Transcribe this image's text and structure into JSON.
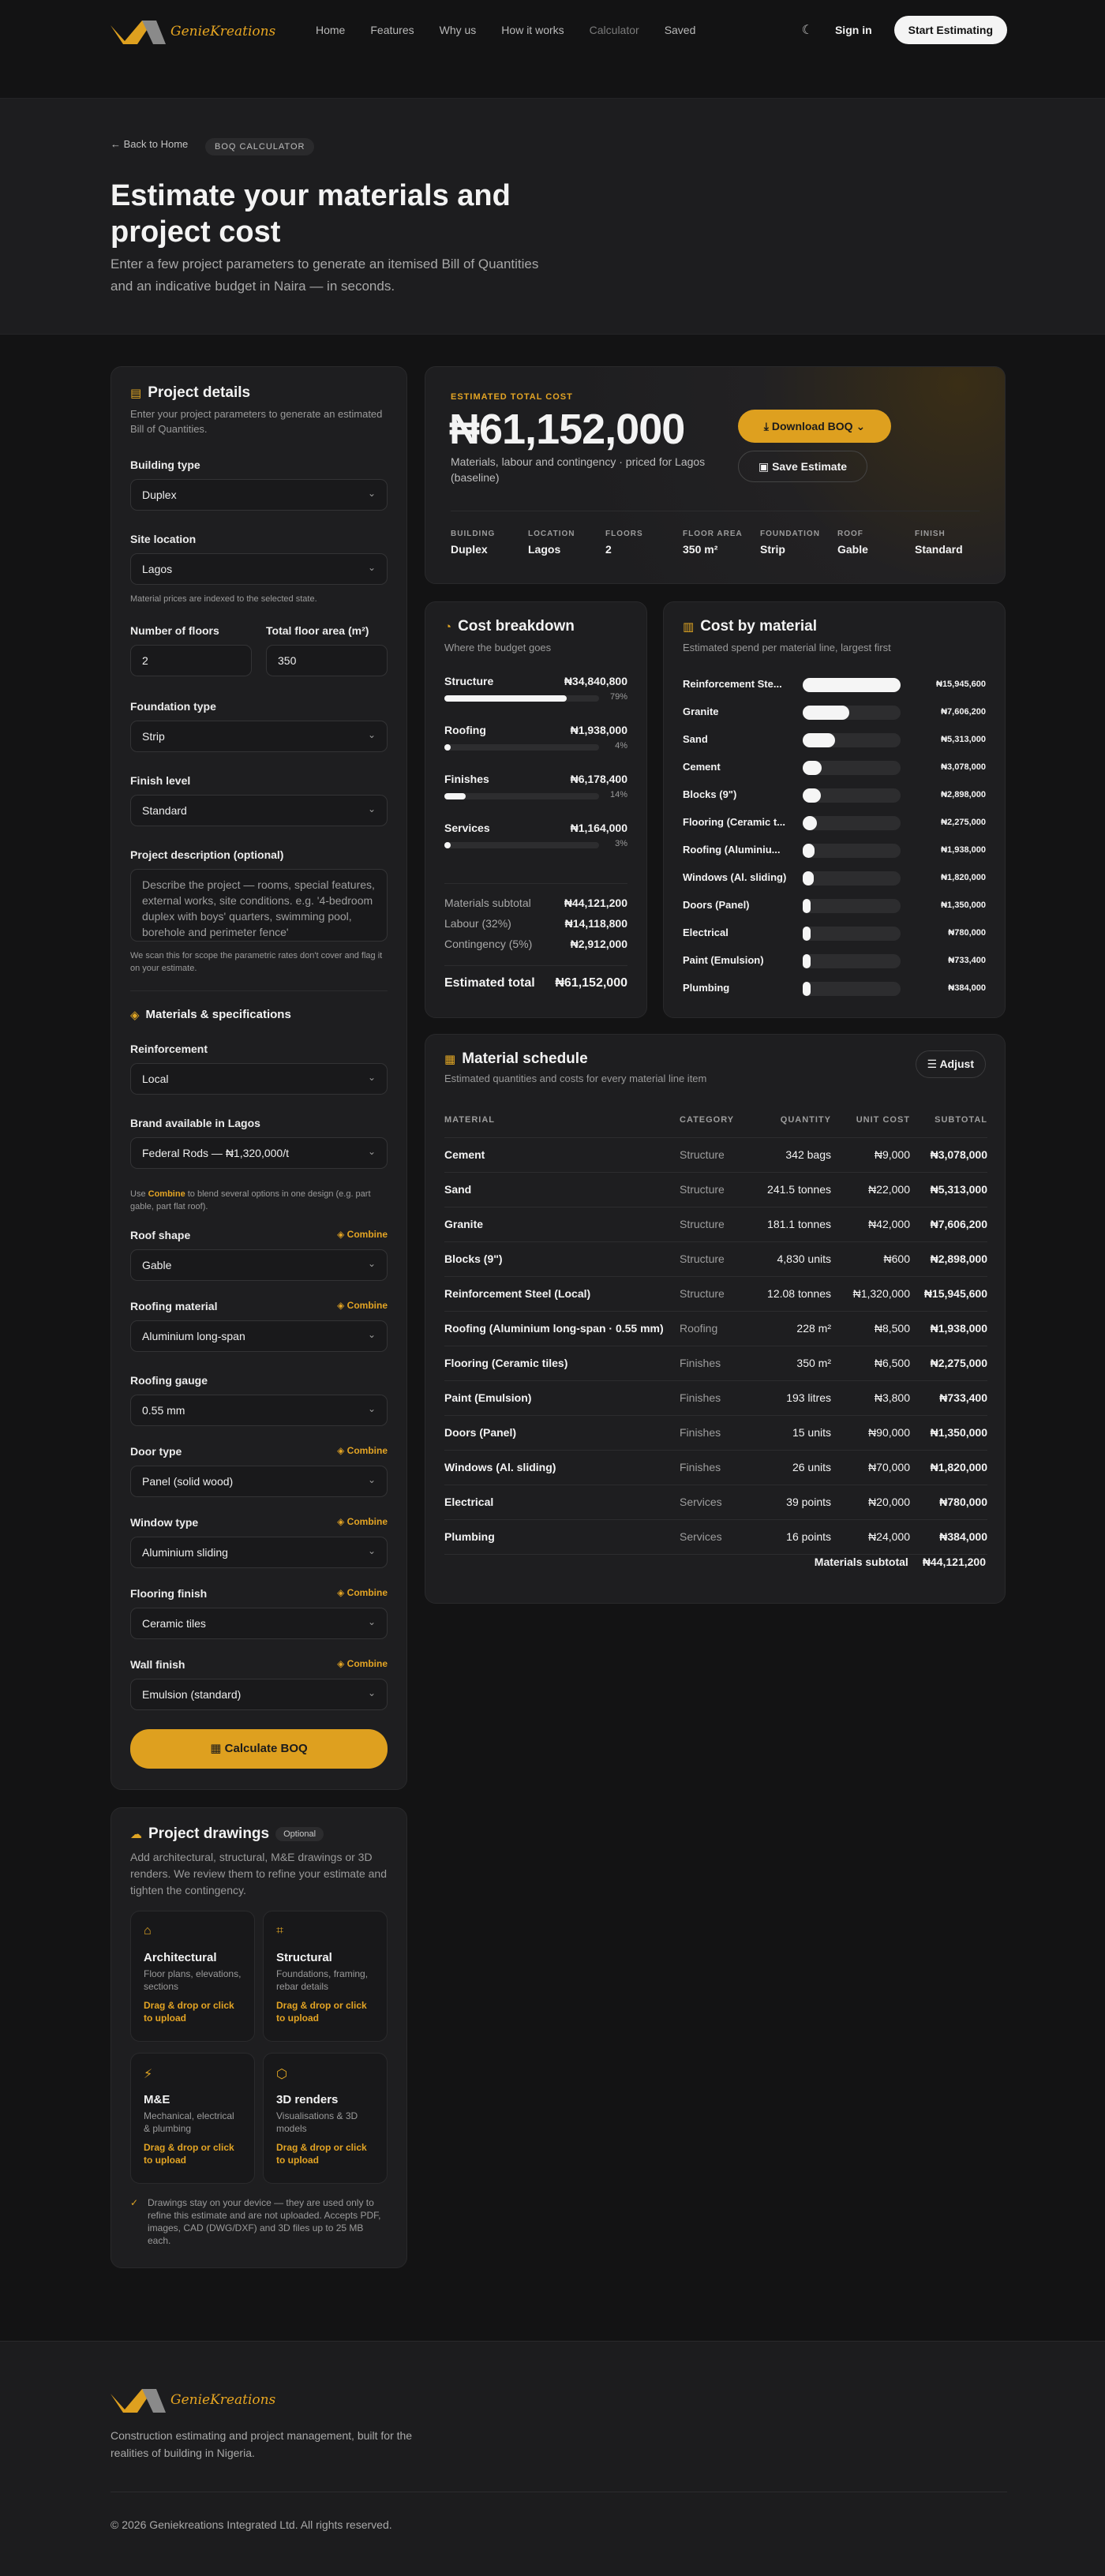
{
  "nav": {
    "brand": "GenieKreations",
    "links": [
      "Home",
      "Features",
      "Why us",
      "How it works",
      "Calculator",
      "Saved"
    ],
    "signin": "Sign in",
    "cta": "Start Estimating"
  },
  "hero": {
    "back": "Back to Home",
    "pill": "BOQ CALCULATOR",
    "title": "Estimate your materials and project cost",
    "desc": "Enter a few project parameters to generate an itemised Bill of Quantities and an indicative budget in Naira — in seconds."
  },
  "form": {
    "title": "Project details",
    "sub": "Enter your project parameters to generate an estimated Bill of Quantities.",
    "building_label": "Building type",
    "building": "Duplex",
    "site_label": "Site location",
    "site": "Lagos",
    "site_note": "Material prices are indexed to the selected state.",
    "floors_label": "Number of floors",
    "floors": "2",
    "area_label": "Total floor area (m²)",
    "area": "350",
    "foundation_label": "Foundation type",
    "foundation": "Strip",
    "finish_label": "Finish level",
    "finish": "Standard",
    "desc_label": "Project description (optional)",
    "desc_placeholder": "Describe the project — rooms, special features, external works, site conditions. e.g. '4-bedroom duplex with boys' quarters, swimming pool, borehole and perimeter fence'",
    "desc_note": "We scan this for scope the parametric rates don't cover and flag it on your estimate.",
    "mat_title": "Materials & specifications",
    "reinf_label": "Reinforcement",
    "reinf": "Local",
    "brand_label": "Brand available in Lagos",
    "brand": "Federal Rods — ₦1,320,000/t",
    "combine_note_a": "Use",
    "combine_word": "Combine",
    "combine_note_b": "to blend several options in one design (e.g. part gable, part flat roof).",
    "combine": "Combine",
    "roof_label": "Roof shape",
    "roof": "Gable",
    "roofmat_label": "Roofing material",
    "roofmat": "Aluminium long-span",
    "gauge_label": "Roofing gauge",
    "gauge": "0.55 mm",
    "door_label": "Door type",
    "door": "Panel (solid wood)",
    "window_label": "Window type",
    "window": "Aluminium sliding",
    "floor_label": "Flooring finish",
    "floor": "Ceramic tiles",
    "wall_label": "Wall finish",
    "wall": "Emulsion (standard)",
    "calc": "Calculate BOQ"
  },
  "drawings": {
    "title": "Project drawings",
    "optional": "Optional",
    "sub": "Add architectural, structural, M&E drawings or 3D renders. We review them to refine your estimate and tighten the contingency.",
    "items": [
      {
        "t": "Architectural",
        "d": "Floor plans, elevations, sections",
        "a": "Drag & drop or click to upload"
      },
      {
        "t": "Structural",
        "d": "Foundations, framing, rebar details",
        "a": "Drag & drop or click to upload"
      },
      {
        "t": "M&E",
        "d": "Mechanical, electrical & plumbing",
        "a": "Drag & drop or click to upload"
      },
      {
        "t": "3D renders",
        "d": "Visualisations & 3D models",
        "a": "Drag & drop or click to upload"
      }
    ],
    "note": "Drawings stay on your device — they are used only to refine this estimate and are not uploaded. Accepts PDF, images, CAD (DWG/DXF) and 3D files up to 25 MB each."
  },
  "total": {
    "label": "ESTIMATED TOTAL COST",
    "value": "₦61,152,000",
    "desc": "Materials, labour and contingency · priced for Lagos (baseline)",
    "download": "Download BOQ",
    "save": "Save Estimate",
    "specs": [
      {
        "k": "BUILDING",
        "v": "Duplex"
      },
      {
        "k": "LOCATION",
        "v": "Lagos"
      },
      {
        "k": "FLOORS",
        "v": "2"
      },
      {
        "k": "FLOOR AREA",
        "v": "350 m²"
      },
      {
        "k": "FOUNDATION",
        "v": "Strip"
      },
      {
        "k": "ROOF",
        "v": "Gable"
      },
      {
        "k": "FINISH",
        "v": "Standard"
      }
    ]
  },
  "breakdown": {
    "title": "Cost breakdown",
    "sub": "Where the budget goes",
    "items": [
      {
        "name": "Structure",
        "value": "₦34,840,800",
        "pct": "79%",
        "frac": 0.79
      },
      {
        "name": "Roofing",
        "value": "₦1,938,000",
        "pct": "4%",
        "frac": 0.04
      },
      {
        "name": "Finishes",
        "value": "₦6,178,400",
        "pct": "14%",
        "frac": 0.14
      },
      {
        "name": "Services",
        "value": "₦1,164,000",
        "pct": "3%",
        "frac": 0.03
      }
    ],
    "subtotal_k": "Materials subtotal",
    "subtotal": "₦44,121,200",
    "labour_k": "Labour (32%)",
    "labour": "₦14,118,800",
    "cont_k": "Contingency (5%)",
    "cont": "₦2,912,000",
    "total_k": "Estimated total",
    "total": "₦61,152,000"
  },
  "bymat": {
    "title": "Cost by material",
    "sub": "Estimated spend per material line, largest first",
    "items": [
      {
        "name": "Reinforcement Ste...",
        "value": "₦15,945,600",
        "v": 15945600
      },
      {
        "name": "Granite",
        "value": "₦7,606,200",
        "v": 7606200
      },
      {
        "name": "Sand",
        "value": "₦5,313,000",
        "v": 5313000
      },
      {
        "name": "Cement",
        "value": "₦3,078,000",
        "v": 3078000
      },
      {
        "name": "Blocks (9\")",
        "value": "₦2,898,000",
        "v": 2898000
      },
      {
        "name": "Flooring (Ceramic t...",
        "value": "₦2,275,000",
        "v": 2275000
      },
      {
        "name": "Roofing (Aluminiu...",
        "value": "₦1,938,000",
        "v": 1938000
      },
      {
        "name": "Windows (Al. sliding)",
        "value": "₦1,820,000",
        "v": 1820000
      },
      {
        "name": "Doors (Panel)",
        "value": "₦1,350,000",
        "v": 1350000
      },
      {
        "name": "Electrical",
        "value": "₦780,000",
        "v": 780000
      },
      {
        "name": "Paint (Emulsion)",
        "value": "₦733,400",
        "v": 733400
      },
      {
        "name": "Plumbing",
        "value": "₦384,000",
        "v": 384000
      }
    ]
  },
  "schedule": {
    "title": "Material schedule",
    "sub": "Estimated quantities and costs for every material line item",
    "adjust": "Adjust",
    "headers": [
      "MATERIAL",
      "CATEGORY",
      "QUANTITY",
      "UNIT COST",
      "SUBTOTAL"
    ],
    "rows": [
      [
        "Cement",
        "Structure",
        "342 bags",
        "₦9,000",
        "₦3,078,000"
      ],
      [
        "Sand",
        "Structure",
        "241.5 tonnes",
        "₦22,000",
        "₦5,313,000"
      ],
      [
        "Granite",
        "Structure",
        "181.1 tonnes",
        "₦42,000",
        "₦7,606,200"
      ],
      [
        "Blocks (9\")",
        "Structure",
        "4,830 units",
        "₦600",
        "₦2,898,000"
      ],
      [
        "Reinforcement Steel (Local)",
        "Structure",
        "12.08 tonnes",
        "₦1,320,000",
        "₦15,945,600"
      ],
      [
        "Roofing (Aluminium long-span · 0.55 mm)",
        "Roofing",
        "228 m²",
        "₦8,500",
        "₦1,938,000"
      ],
      [
        "Flooring (Ceramic tiles)",
        "Finishes",
        "350 m²",
        "₦6,500",
        "₦2,275,000"
      ],
      [
        "Paint (Emulsion)",
        "Finishes",
        "193 litres",
        "₦3,800",
        "₦733,400"
      ],
      [
        "Doors (Panel)",
        "Finishes",
        "15 units",
        "₦90,000",
        "₦1,350,000"
      ],
      [
        "Windows (Al. sliding)",
        "Finishes",
        "26 units",
        "₦70,000",
        "₦1,820,000"
      ],
      [
        "Electrical",
        "Services",
        "39 points",
        "₦20,000",
        "₦780,000"
      ],
      [
        "Plumbing",
        "Services",
        "16 points",
        "₦24,000",
        "₦384,000"
      ]
    ],
    "subtotal_k": "Materials subtotal",
    "subtotal": "₦44,121,200"
  },
  "footer": {
    "brand": "GenieKreations",
    "tagline": "Construction estimating and project management, built for the realities of building in Nigeria.",
    "copy": "© 2026 Geniekreations Integrated Ltd. All rights reserved."
  },
  "colors": {
    "accent": "#dea01f",
    "bg": "#131314",
    "card": "#1e1e20"
  }
}
